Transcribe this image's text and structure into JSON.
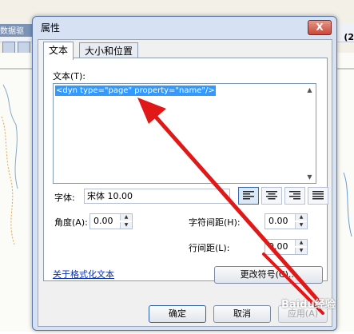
{
  "background_app": {
    "title_fragment": "数据驱",
    "right_label_fragment": "(2"
  },
  "dialog": {
    "title": "属性",
    "close_label": "X",
    "tabs": [
      {
        "label": "文本",
        "active": true
      },
      {
        "label": "大小和位置",
        "active": false
      }
    ],
    "text_label": "文本(T):",
    "text_value": "<dyn type=\"page\" property=\"name\"/>",
    "font_label": "字体:",
    "font_value": "宋体 10.00",
    "alignment_options": [
      "left",
      "center",
      "right",
      "justify"
    ],
    "alignment_selected": "left",
    "angle_label": "角度(A):",
    "angle_value": "0.00",
    "char_spacing_label": "字符间距(H):",
    "char_spacing_value": "0.00",
    "line_spacing_label": "行间距(L):",
    "line_spacing_value": "0.00",
    "format_link": "关于格式化文本",
    "change_symbol_button": "更改符号(C)...",
    "ok_button": "确定",
    "cancel_button": "取消",
    "apply_button": "应用(A)"
  },
  "watermark": "Baidu经验",
  "colors": {
    "arrow": "#e01818",
    "selection": "#3399ff",
    "link": "#0d2fb0"
  }
}
